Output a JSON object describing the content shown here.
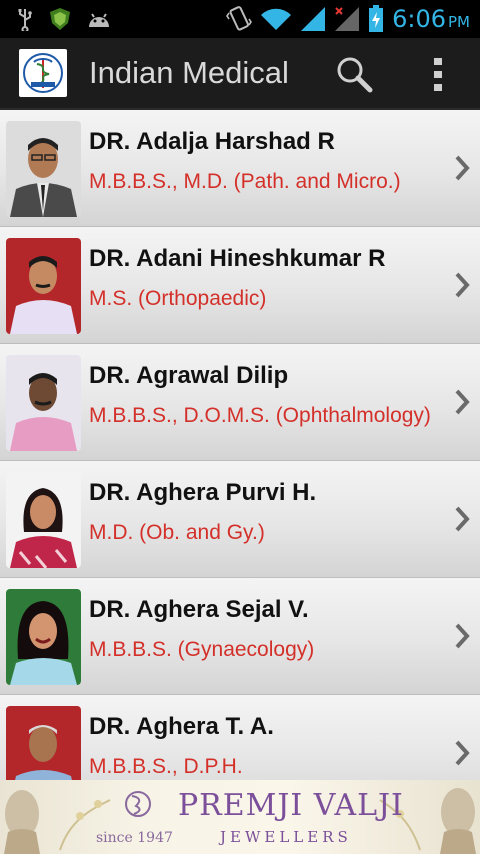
{
  "status_bar": {
    "time": "6:06",
    "ampm": "PM",
    "icons": [
      "usb-icon",
      "shield-icon",
      "android-icon",
      "vibrate-icon",
      "wifi-icon",
      "signal-icon",
      "signal-no-data-icon",
      "battery-charging-icon"
    ]
  },
  "action_bar": {
    "title": "Indian Medical",
    "search_icon": "search-icon",
    "overflow_icon": "overflow-menu-icon"
  },
  "doctors": [
    {
      "name": "DR. Adalja Harshad R",
      "degree": "M.B.B.S., M.D. (Path. and Micro.)",
      "photo_bg": "#dcdcdc"
    },
    {
      "name": "DR. Adani Hineshkumar R",
      "degree": "M.S. (Orthopaedic)",
      "photo_bg": "#b3272b"
    },
    {
      "name": "DR. Agrawal Dilip",
      "degree": "M.B.B.S., D.O.M.S. (Ophthalmology)",
      "photo_bg": "#e8e4ee"
    },
    {
      "name": "DR. Aghera Purvi H.",
      "degree": "M.D. (Ob. and Gy.)",
      "photo_bg": "#f3f3f3"
    },
    {
      "name": "DR. Aghera Sejal V.",
      "degree": "M.B.B.S. (Gynaecology)",
      "photo_bg": "#2f7c3a"
    },
    {
      "name": "DR. Aghera T. A.",
      "degree": "M.B.B.S., D.P.H.",
      "photo_bg": "#b3272b"
    }
  ],
  "ad": {
    "brand": "PREMJI VALJI",
    "tagline": "JEWELLERS",
    "since": "since 1947"
  },
  "colors": {
    "accent_blue": "#33b5e5",
    "degree_red": "#d4302a",
    "action_bar": "#1c1c1c"
  }
}
